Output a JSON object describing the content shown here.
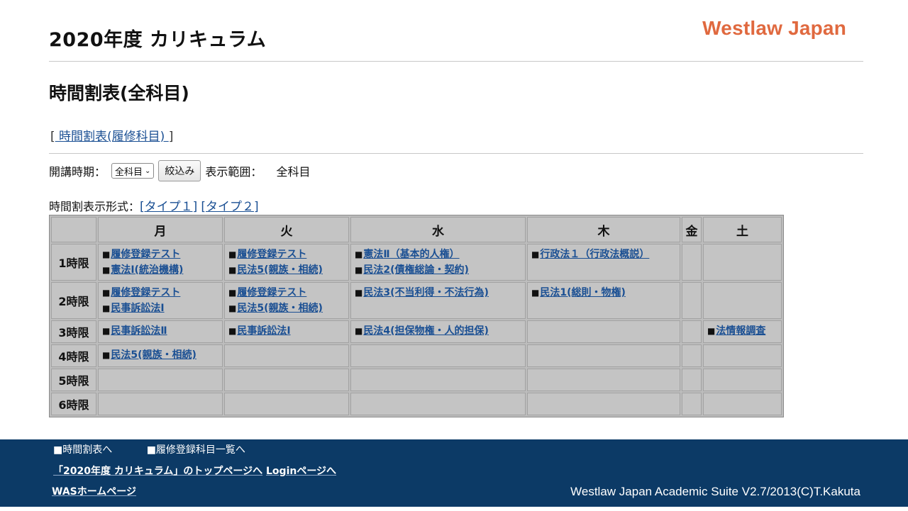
{
  "header": {
    "site_title": "2020年度 カリキュラム",
    "brand": "Westlaw Japan",
    "brand_color": "#e0693f"
  },
  "section_title": "時間割表(全科目)",
  "bracket_link": {
    "open": "[",
    "label": " 時間割表(履修科目) ",
    "close": "]"
  },
  "filter": {
    "term_label": "開講時期：",
    "term_selected": "全科目",
    "submit_label": "絞込み",
    "range_label": "表示範囲：",
    "range_value": "全科目"
  },
  "format": {
    "label": "時間割表示形式：",
    "type1": "[タイプ１]",
    "type2": "[タイプ２]"
  },
  "timetable": {
    "days": [
      "月",
      "火",
      "水",
      "木",
      "金",
      "土"
    ],
    "periods": [
      {
        "label": "1時限",
        "cells": [
          [
            "履修登録テスト",
            "憲法Ⅰ(統治機構)"
          ],
          [
            "履修登録テスト",
            "民法5(親族・相続)"
          ],
          [
            "憲法Ⅱ（基本的人権）",
            "民法2(債権総論・契約)"
          ],
          [
            "行政法１（行政法概説）"
          ],
          [],
          []
        ]
      },
      {
        "label": "2時限",
        "cells": [
          [
            "履修登録テスト",
            "民事訴訟法Ⅰ"
          ],
          [
            "履修登録テスト",
            "民法5(親族・相続)"
          ],
          [
            "民法3(不当利得・不法行為)"
          ],
          [
            "民法1(総則・物権)"
          ],
          [],
          []
        ]
      },
      {
        "label": "3時限",
        "cells": [
          [
            "民事訴訟法Ⅱ"
          ],
          [
            "民事訴訟法Ⅰ"
          ],
          [
            "民法4(担保物権・人的担保)"
          ],
          [],
          [],
          [
            "法情報調査"
          ]
        ]
      },
      {
        "label": "4時限",
        "cells": [
          [
            "民法5(親族・相続)"
          ],
          [],
          [],
          [],
          [],
          []
        ]
      },
      {
        "label": "5時限",
        "cells": [
          [],
          [],
          [],
          [],
          [],
          []
        ]
      },
      {
        "label": "6時限",
        "cells": [
          [],
          [],
          [],
          [],
          [],
          []
        ]
      }
    ]
  },
  "footer": {
    "link_timetable": "■時間割表へ",
    "link_course_list": "■履修登録科目一覧へ",
    "link_top": "「2020年度 カリキュラム」のトップページへ",
    "link_login": "Loginページへ",
    "link_was": "WASホームページ",
    "credit": "Westlaw Japan Academic Suite V2.7/2013(C)T.Kakuta",
    "bg_color": "#0c3a66"
  }
}
